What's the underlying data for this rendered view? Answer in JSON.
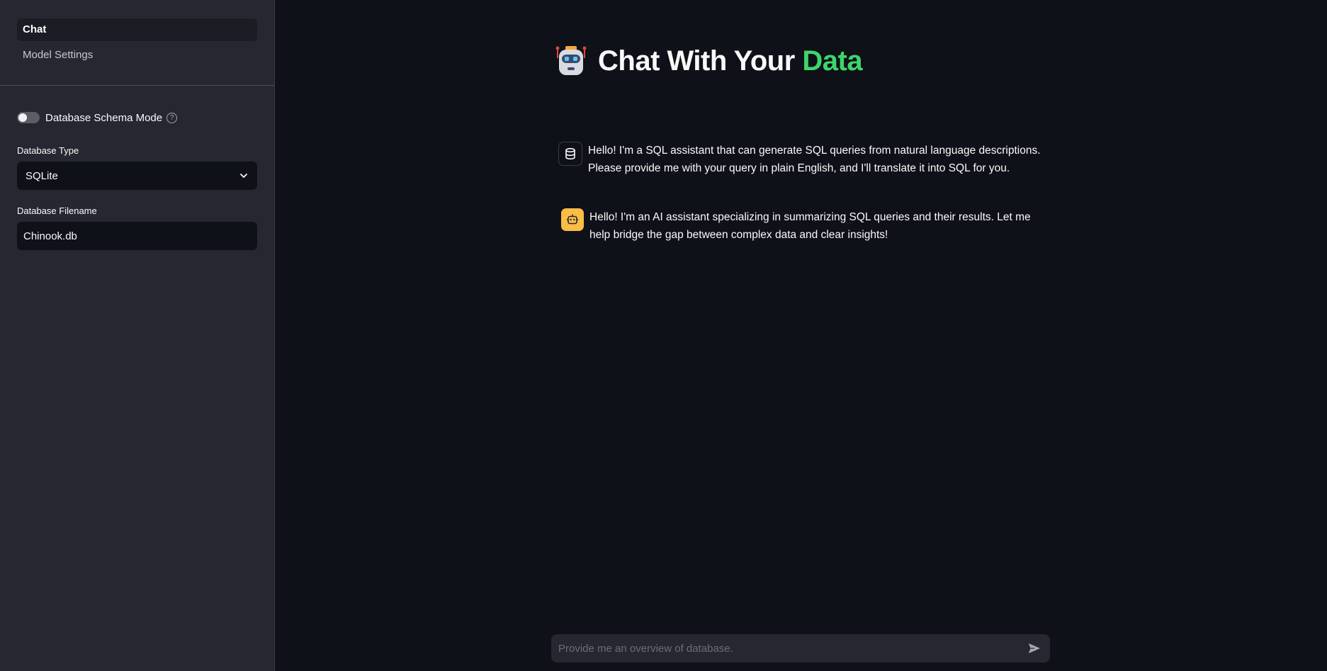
{
  "sidebar": {
    "nav": [
      {
        "label": "Chat",
        "active": true
      },
      {
        "label": "Model Settings",
        "active": false
      }
    ],
    "schema_toggle": {
      "label": "Database Schema Mode",
      "on": false,
      "help_icon": "question-circle-icon"
    },
    "db_type": {
      "label": "Database Type",
      "value": "SQLite",
      "icon": "chevron-down-icon"
    },
    "db_filename": {
      "label": "Database Filename",
      "value": "Chinook.db"
    }
  },
  "header": {
    "icon": "robot-icon",
    "title_main": "Chat With Your ",
    "title_accent": "Data",
    "accent_color": "#3dd56d"
  },
  "messages": [
    {
      "avatar": "database-icon",
      "text": "Hello! I'm a SQL assistant that can generate SQL queries from natural language descriptions. Please provide me with your query in plain English, and I'll translate it into SQL for you."
    },
    {
      "avatar": "bot-icon",
      "avatar_color": "#ffbd45",
      "text": "Hello! I'm an AI assistant specializing in summarizing SQL queries and their results. Let me help bridge the gap between complex data and clear insights!"
    }
  ],
  "chat_input": {
    "placeholder": "Provide me an overview of database.",
    "value": "",
    "send_icon": "send-icon"
  }
}
